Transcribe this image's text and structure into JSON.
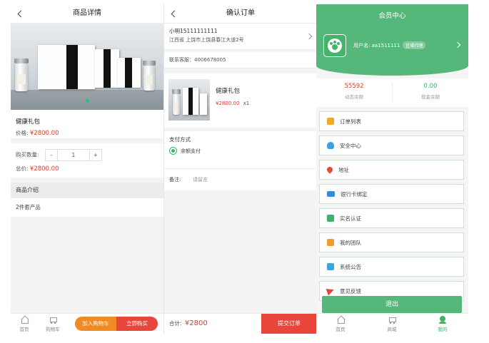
{
  "product_page": {
    "title": "商品详情",
    "product_name": "健康礼包",
    "price_label": "价格:",
    "price": "¥2800.00",
    "qty_label": "购买数量:",
    "minus": "-",
    "qty": "1",
    "plus": "+",
    "total_label": "总价:",
    "total": "¥2800.00",
    "intro_title": "商品介绍",
    "intro_text": "2件套产品",
    "tabs": {
      "home": "首页",
      "cart": "购物车"
    },
    "add_cart": "加入购物车",
    "buy_now": "立即购买"
  },
  "order_page": {
    "title": "确认订单",
    "recipient": "小明15111111111",
    "address": "江西省 上饶市上饶县春江大道2号",
    "service": "联系客服：4006678005",
    "item_name": "健康礼包",
    "item_price": "¥2800.00",
    "item_qty": "x1",
    "payment_title": "支付方式",
    "payment_option": "余额支付",
    "remark_label": "备注:",
    "remark_placeholder": "请留言",
    "total_label": "合计:",
    "total": "¥2800",
    "submit": "提交订单"
  },
  "member_page": {
    "title": "会员中心",
    "username": "用户名: aa1511111",
    "badge": "区域代理",
    "balance_value": "55592",
    "balance_label": "动态余额",
    "cash_value": "0.00",
    "cash_label": "现金余额",
    "menu": [
      {
        "label": "订单列表",
        "icon": "order-icon",
        "color": "#f5a623"
      },
      {
        "label": "安全中心",
        "icon": "cloud-icon",
        "color": "#3aa0e6"
      },
      {
        "label": "地址",
        "icon": "location-icon",
        "color": "#e54a3a"
      },
      {
        "label": "银行卡绑定",
        "icon": "card-icon",
        "color": "#2f8fd8"
      },
      {
        "label": "实名认证",
        "icon": "id-icon",
        "color": "#3bb36b"
      },
      {
        "label": "我的团队",
        "icon": "team-icon",
        "color": "#f39c2b"
      },
      {
        "label": "系统公告",
        "icon": "notice-icon",
        "color": "#3aa6e0"
      },
      {
        "label": "意见反馈",
        "icon": "feedback-icon",
        "color": "#e2463c"
      }
    ],
    "logout": "退出",
    "tabs": {
      "home": "首页",
      "mall": "商城",
      "mine": "我的"
    }
  },
  "colors": {
    "green": "#55b87a",
    "red": "#e03c2b",
    "orange": "#f08a24"
  }
}
